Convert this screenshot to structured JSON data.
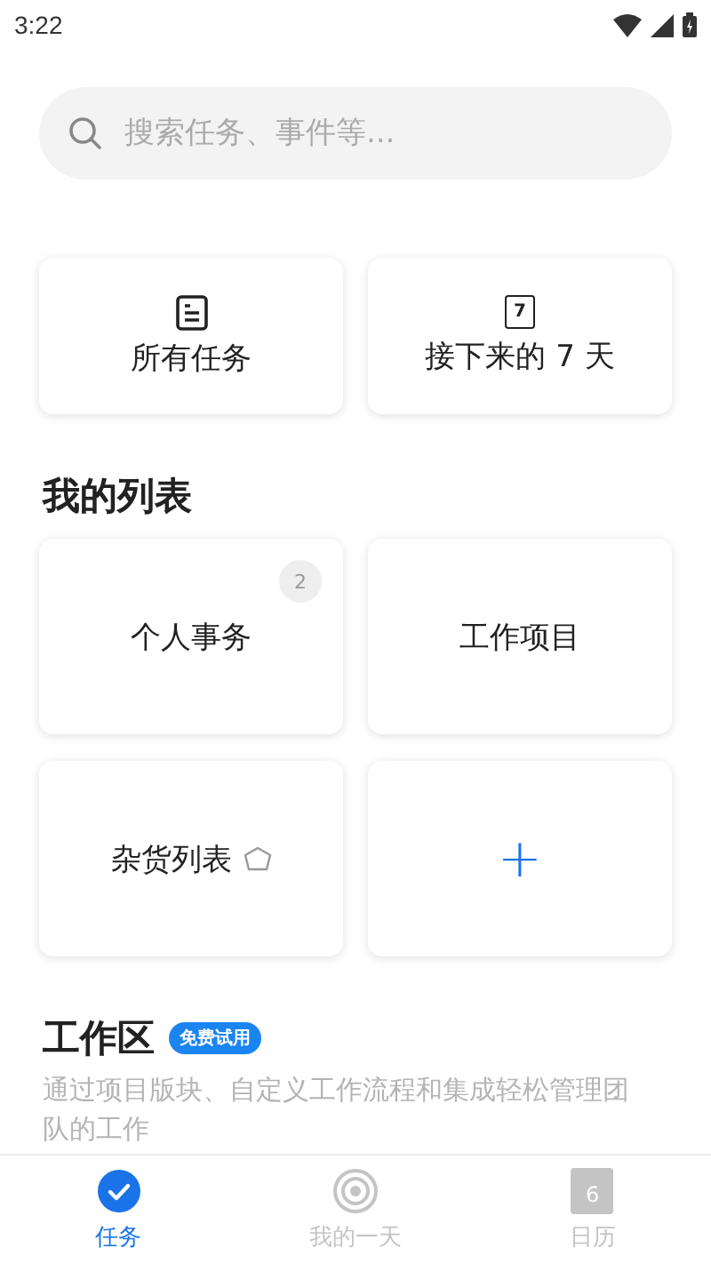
{
  "status_bar": {
    "time": "3:22"
  },
  "search": {
    "placeholder": "搜索任务、事件等..."
  },
  "smart_lists": [
    {
      "kind": "all",
      "label": "所有任务"
    },
    {
      "kind": "next7",
      "label": "接下来的 7 天",
      "icon_text": "7"
    }
  ],
  "my_lists": {
    "title": "我的列表",
    "items": [
      {
        "kind": "list",
        "label": "个人事务",
        "count": "2"
      },
      {
        "kind": "list",
        "label": "工作项目"
      },
      {
        "kind": "grocery",
        "label": "杂货列表"
      },
      {
        "kind": "add",
        "label": "+"
      }
    ]
  },
  "workspace": {
    "title": "工作区",
    "badge": "免费试用",
    "description": "通过项目版块、自定义工作流程和集成轻松管理团队的工作"
  },
  "bottom_nav": [
    {
      "kind": "tasks",
      "label": "任务",
      "selected": true
    },
    {
      "kind": "myday",
      "label": "我的一天",
      "selected": false
    },
    {
      "kind": "calendar",
      "label": "日历",
      "icon_text": "6",
      "selected": false
    }
  ]
}
